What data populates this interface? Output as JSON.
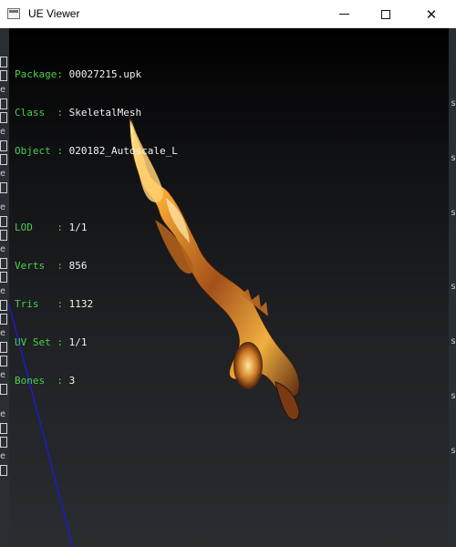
{
  "window": {
    "title": "UE Viewer",
    "icon": "app-window-icon",
    "controls": {
      "minimize": "minimize-icon",
      "maximize": "maximize-icon",
      "close": "✕"
    }
  },
  "info": {
    "package_label": "Package:",
    "package_value": "00027215.upk",
    "class_label": "Class  :",
    "class_value": "SkeletalMesh",
    "object_label": "Object :",
    "object_value": "020182_Autoscale_L",
    "lod_label": "LOD    :",
    "lod_value": "1/1",
    "verts_label": "Verts  :",
    "verts_value": "856",
    "tris_label": "Tris   :",
    "tris_value": "1132",
    "uvset_label": "UV Set :",
    "uvset_value": "1/1",
    "bones_label": "Bones  :",
    "bones_value": "3"
  },
  "edge_glyphs": [
    "e",
    "e",
    "e",
    "e",
    "e",
    "e",
    "e",
    "e",
    "e",
    "e"
  ],
  "right_glyphs": [
    "s",
    "s",
    "s",
    "s",
    "s",
    "s",
    "s"
  ],
  "colors": {
    "label_green": "#4ad04a",
    "value_white": "#f2f2f2",
    "axis_blue": "#1a1ad8",
    "model_orange": "#e08a2a"
  }
}
